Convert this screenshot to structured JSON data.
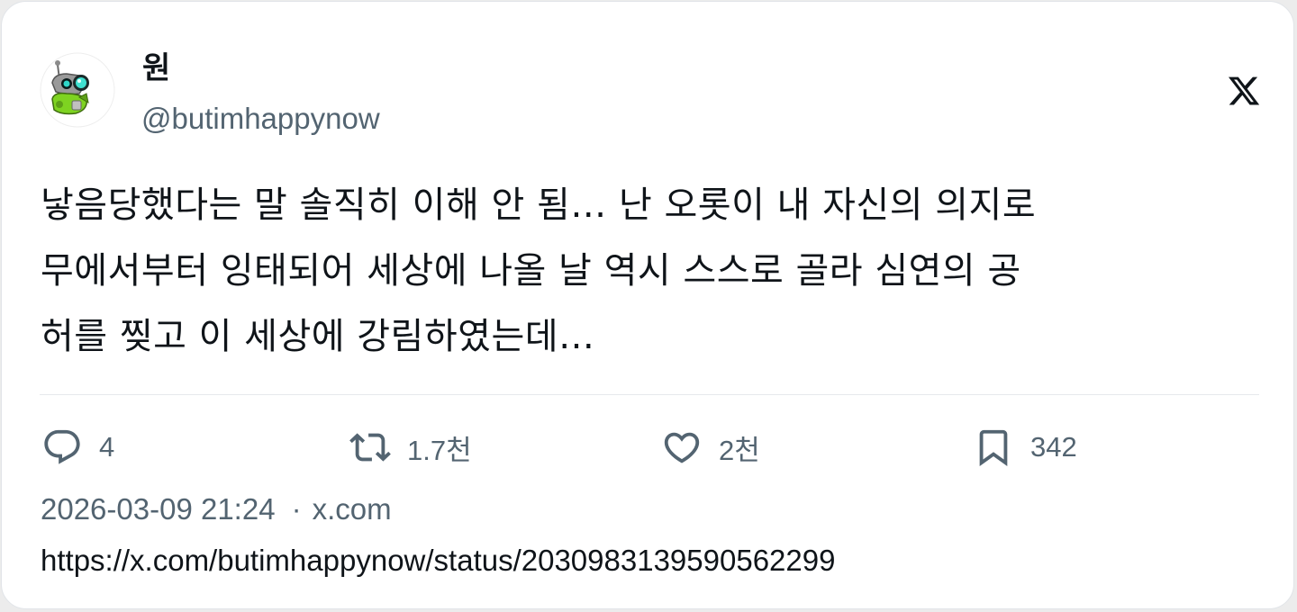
{
  "author": {
    "display_name": "원",
    "handle": "@butimhappynow",
    "avatar_icon": "cartoon-robot-avatar"
  },
  "brand_icon": "x-logo-icon",
  "tweet": {
    "text": "낳음당했다는 말 솔직히 이해 안 됨… 난 오롯이 내 자신의 의지로\n무에서부터 잉태되어 세상에 나올 날 역시 스스로 골라 심연의 공\n허를 찢고 이 세상에 강림하였는데…"
  },
  "actions": {
    "reply": {
      "icon": "reply-icon",
      "count": "4"
    },
    "repost": {
      "icon": "repost-icon",
      "count": "1.7천"
    },
    "like": {
      "icon": "heart-icon",
      "count": "2천"
    },
    "bookmark": {
      "icon": "bookmark-icon",
      "count": "342"
    }
  },
  "meta": {
    "timestamp": "2026-03-09 21:24",
    "separator": "·",
    "source": "x.com"
  },
  "url": "https://x.com/butimhappynow/status/2030983139590562299",
  "colors": {
    "text": "#0f1419",
    "secondary": "#536471",
    "divider": "#e6e9ec",
    "card_bg": "#ffffff"
  }
}
